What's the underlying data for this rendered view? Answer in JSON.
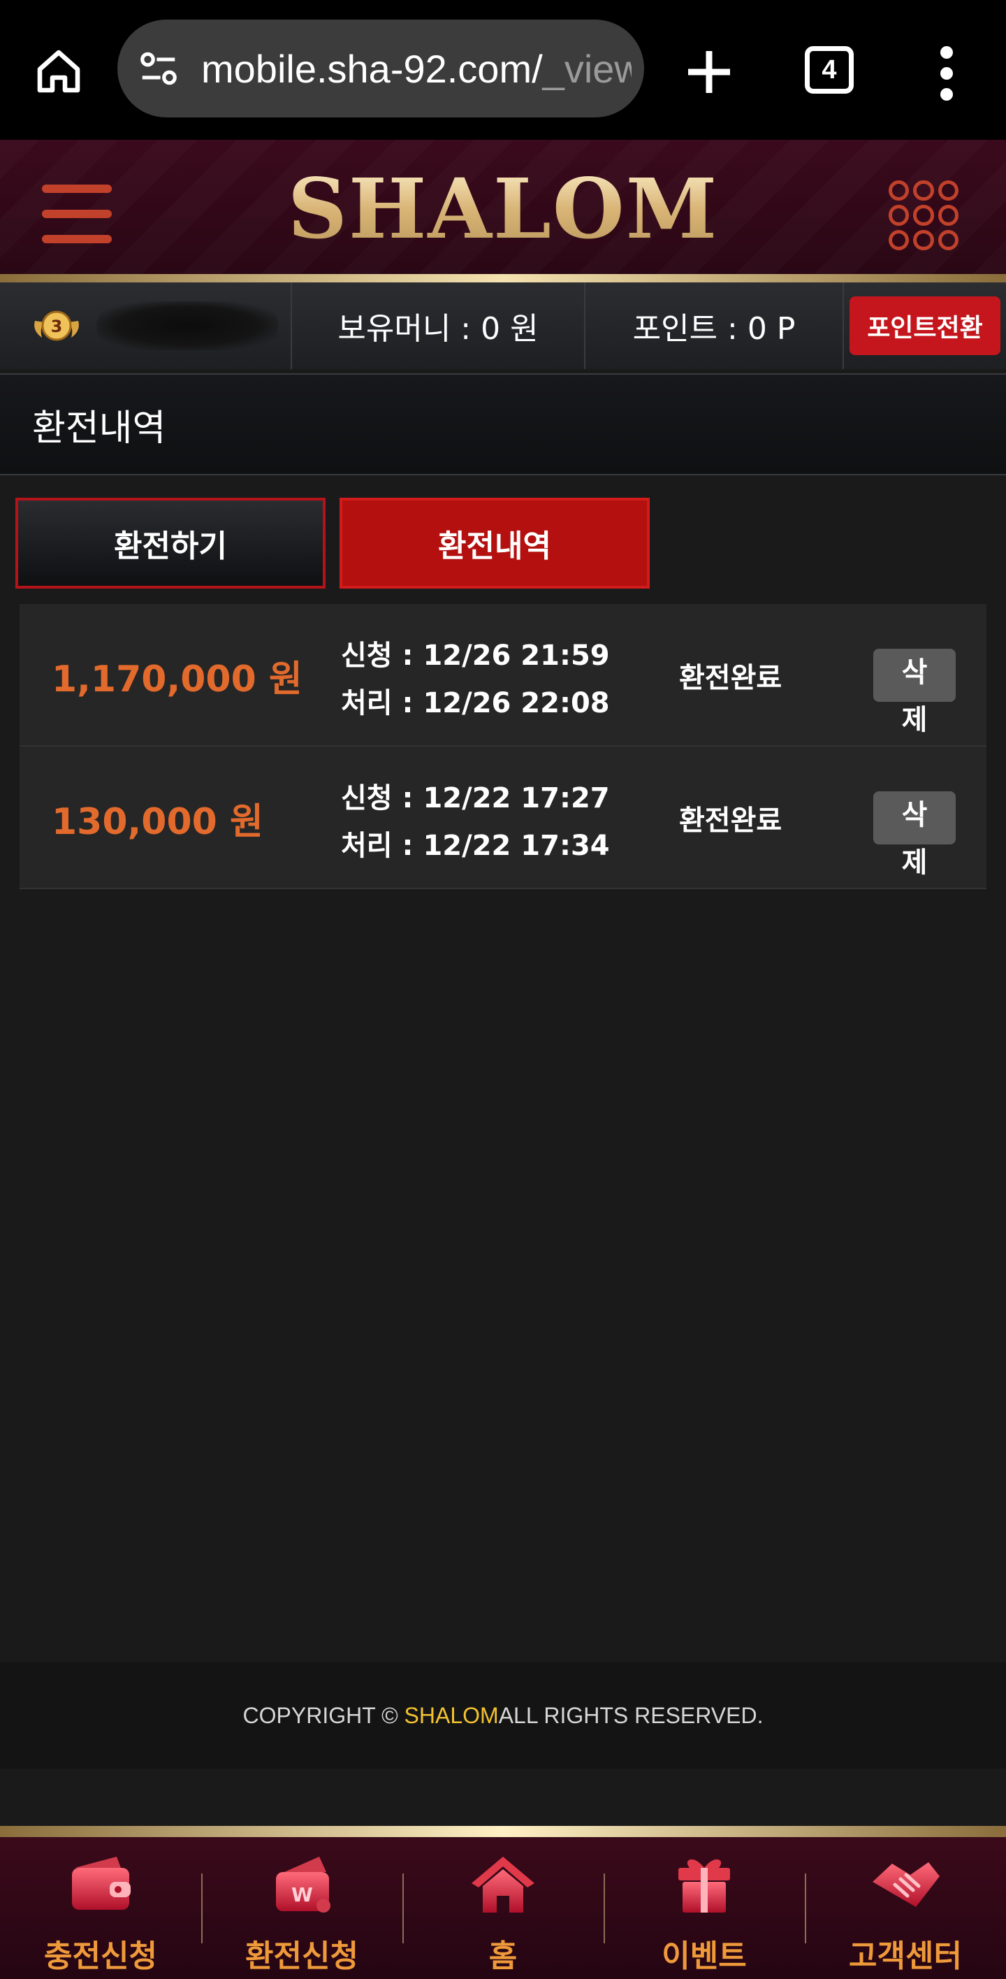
{
  "browser": {
    "url_main": "mobile.sha-92.com/",
    "url_dim": "_view",
    "tab_count": "4"
  },
  "header": {
    "logo_text": "SHALOM"
  },
  "user_bar": {
    "level": "3",
    "money_label": "보유머니 : 0 원",
    "point_label": "포인트 : 0 P",
    "convert_button": "포인트전환"
  },
  "page_title": "환전내역",
  "tabs": {
    "exchange": "환전하기",
    "history": "환전내역"
  },
  "history": [
    {
      "amount": "1,170,000 원",
      "requested": "신청 : 12/26 21:59",
      "processed": "처리 : 12/26 22:08",
      "status": "환전완료",
      "delete_label": "삭제"
    },
    {
      "amount": "130,000 원",
      "requested": "신청 : 12/22 17:27",
      "processed": "처리 : 12/22 17:34",
      "status": "환전완료",
      "delete_label": "삭제"
    }
  ],
  "footer": {
    "prefix": "COPYRIGHT © ",
    "brand": "SHALOM",
    "suffix": " ALL RIGHTS RESERVED."
  },
  "bottom_nav": {
    "items": [
      {
        "label": "충전신청",
        "icon": "wallet-icon"
      },
      {
        "label": "환전신청",
        "icon": "exchange-wallet-icon"
      },
      {
        "label": "홈",
        "icon": "home-icon"
      },
      {
        "label": "이벤트",
        "icon": "gift-icon"
      },
      {
        "label": "고객센터",
        "icon": "handshake-icon"
      }
    ]
  },
  "colors": {
    "accent_red": "#c4161c",
    "amount_orange": "#e26a2c",
    "gold": "#e7c98d",
    "nav_label": "#ef9a3a"
  }
}
